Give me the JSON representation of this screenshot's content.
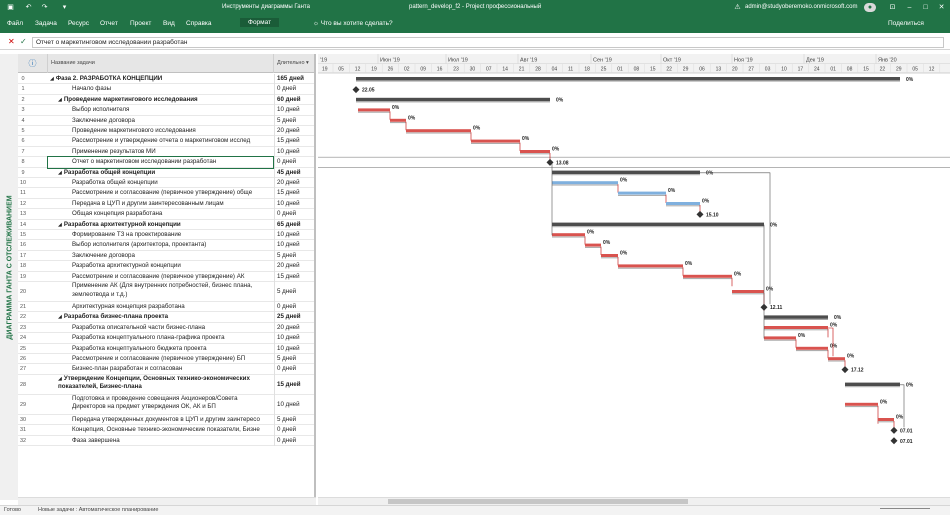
{
  "titlebar": {
    "context": "Инструменты диаграммы Ганта",
    "doc_title": "pattern_develop_f2  -  Project профессиональный",
    "user": "admin@studyoberemoko.onmicrosoft.com"
  },
  "ribbon": {
    "tabs": [
      "Файл",
      "Задача",
      "Ресурс",
      "Отчет",
      "Проект",
      "Вид",
      "Справка",
      "Формат"
    ],
    "tell_me": "Что вы хотите сделать?",
    "share": "Поделиться"
  },
  "formula_bar": {
    "cancel": "✕",
    "confirm": "✓",
    "value": "Отчет о маркетинговом исследовании разработан"
  },
  "sidebar_label": "ДИАГРАММА ГАНТА С ОТСЛЕЖИВАНИЕМ",
  "table": {
    "headers": {
      "info": "ⓘ",
      "name": "Название задачи",
      "duration": "Длительно ▾"
    },
    "rows": [
      {
        "id": "0",
        "name": "Фаза 2. РАЗРАБОТКА КОНЦЕПЦИИ",
        "dur": "165 дней",
        "summary": true
      },
      {
        "id": "1",
        "name": "Начало фазы",
        "dur": "0 дней"
      },
      {
        "id": "2",
        "name": "Проведение маркетингового исследования",
        "dur": "60 дней",
        "summary": true
      },
      {
        "id": "3",
        "name": "Выбор исполнителя",
        "dur": "10 дней"
      },
      {
        "id": "4",
        "name": "Заключение договора",
        "dur": "5 дней"
      },
      {
        "id": "5",
        "name": "Проведение маркетингового исследования",
        "dur": "20 дней"
      },
      {
        "id": "6",
        "name": "Рассмотрение и утверждение отчета о маркетинговом исслед",
        "dur": "15 дней"
      },
      {
        "id": "7",
        "name": "Применение результатов МИ",
        "dur": "10 дней"
      },
      {
        "id": "8",
        "name": "Отчет о маркетинговом исследовании разработан",
        "dur": "0 дней",
        "selected": true
      },
      {
        "id": "9",
        "name": "Разработка общей концепции",
        "dur": "45 дней",
        "summary": true
      },
      {
        "id": "10",
        "name": "Разработка общей концепции",
        "dur": "20 дней"
      },
      {
        "id": "11",
        "name": "Рассмотрение и согласование (первичное утверждение) обще",
        "dur": "15 дней"
      },
      {
        "id": "12",
        "name": "Передача в ЦУП и другим заинтересованным лицам",
        "dur": "10 дней"
      },
      {
        "id": "13",
        "name": "Общая концепция разработана",
        "dur": "0 дней"
      },
      {
        "id": "14",
        "name": "Разработка архитектурной концепции",
        "dur": "65 дней",
        "summary": true
      },
      {
        "id": "15",
        "name": "Формирование ТЗ на проектирование",
        "dur": "10 дней"
      },
      {
        "id": "16",
        "name": "Выбор исполнителя (архитектора, проектанта)",
        "dur": "10 дней"
      },
      {
        "id": "17",
        "name": "Заключение договора",
        "dur": "5 дней"
      },
      {
        "id": "18",
        "name": "Разработка архитектурной концепции",
        "dur": "20 дней"
      },
      {
        "id": "19",
        "name": "Рассмотрение и согласование (первичное утверждение) АК",
        "dur": "15 дней"
      },
      {
        "id": "20",
        "name": "Применение АК (Для внутренних потребностей, бизнес плана, землеотвода и т.д.)",
        "dur": "5 дней",
        "multi": true
      },
      {
        "id": "21",
        "name": "Архитектурная концепция разработана",
        "dur": "0 дней"
      },
      {
        "id": "22",
        "name": "Разработка бизнес-плана проекта",
        "dur": "25 дней",
        "summary": true
      },
      {
        "id": "23",
        "name": "Разработка описательной части бизнес-плана",
        "dur": "20 дней"
      },
      {
        "id": "24",
        "name": "Разработка концептуального плана-графика проекта",
        "dur": "10 дней"
      },
      {
        "id": "25",
        "name": "Разработка концептуального бюджета проекта",
        "dur": "10 дней"
      },
      {
        "id": "26",
        "name": "Рассмотрение и согласование (первичное утверждение) БП",
        "dur": "5 дней"
      },
      {
        "id": "27",
        "name": "Бизнес-план разработан и согласован",
        "dur": "0 дней"
      },
      {
        "id": "28",
        "name": "Утверждение Концепции, Основных технико-экономических показателей, Бизнес-плана",
        "dur": "15 дней",
        "summary": true,
        "multi": true
      },
      {
        "id": "29",
        "name": "Подготовка и проведение совещания Акционеров/Совета Директоров на предмет утверждения ОК, АК и БП",
        "dur": "10 дней",
        "multi": true
      },
      {
        "id": "30",
        "name": "Передача утвержденных документов в ЦУП и другим заинтересо",
        "dur": "5 дней"
      },
      {
        "id": "31",
        "name": "Концепция, Основные технико-экономические показатели, Бизне",
        "dur": "0 дней"
      },
      {
        "id": "32",
        "name": "Фаза завершена",
        "dur": "0 дней"
      }
    ]
  },
  "chart_data": {
    "type": "gantt",
    "months": [
      "'19",
      "Июн '19",
      "Июл '19",
      "Авг '19",
      "Сен '19",
      "Окт '19",
      "Ноя '19",
      "Дек '19",
      "Янв '20"
    ],
    "days": [
      "19",
      "05",
      "12",
      "19",
      "26",
      "02",
      "09",
      "16",
      "23",
      "30",
      "07",
      "14",
      "21",
      "28",
      "04",
      "11",
      "18",
      "25",
      "01",
      "08",
      "15",
      "22",
      "29",
      "06",
      "13",
      "20",
      "27",
      "03",
      "10",
      "17",
      "24",
      "01",
      "08",
      "15",
      "22",
      "29",
      "05",
      "12"
    ],
    "milestones": [
      {
        "row": 1,
        "label": "22.05"
      },
      {
        "row": 8,
        "label": "13.08"
      },
      {
        "row": 13,
        "label": "15.10"
      },
      {
        "row": 21,
        "label": "12.11"
      },
      {
        "row": 27,
        "label": "17.12"
      },
      {
        "row": 31,
        "label": "07.01"
      },
      {
        "row": 32,
        "label": "07.01"
      }
    ],
    "percent_labels": [
      "0%"
    ],
    "legend_colors": {
      "summary": "#4d4d4d",
      "critical": "#d9534f",
      "task": "#7fb0de",
      "baseline": "#a6a6a6"
    }
  },
  "status": {
    "ready": "Готово",
    "mode": "Новые задачи : Автоматическое планирование"
  }
}
